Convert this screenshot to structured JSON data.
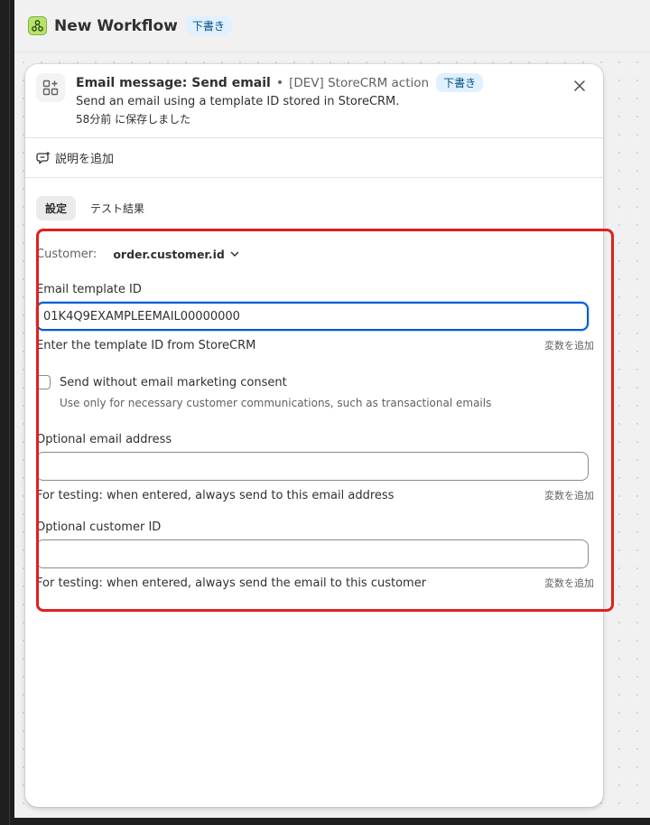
{
  "topbar": {
    "title": "New Workflow",
    "badge": "下書き"
  },
  "panel": {
    "title": "Email message: Send email",
    "subtitle": "[DEV] StoreCRM action",
    "badge": "下書き",
    "description": "Send an email using a template ID stored in StoreCRM.",
    "saved": "58分前 に保存しました",
    "add_description": "説明を追加",
    "tabs": [
      {
        "label": "設定"
      },
      {
        "label": "テスト結果"
      }
    ]
  },
  "form": {
    "customer_label": "Customer:",
    "customer_value": "order.customer.id",
    "template_label": "Email template ID",
    "template_value": "01K4Q9EXAMPLEEMAIL00000000",
    "template_help": "Enter the template ID from StoreCRM",
    "add_variable": "変数を追加",
    "consent_label": "Send without email marketing consent",
    "consent_help": "Use only for necessary customer communications, such as transactional emails",
    "email_label": "Optional email address",
    "email_value": "",
    "email_help": "For testing: when entered, always send to this email address",
    "customer_id_label": "Optional customer ID",
    "customer_id_value": "",
    "customer_id_help": "For testing: when entered, always send the email to this customer"
  },
  "colors": {
    "accent": "#005bd3",
    "badge_bg": "#e0f0ff",
    "highlight": "#e0201e"
  }
}
